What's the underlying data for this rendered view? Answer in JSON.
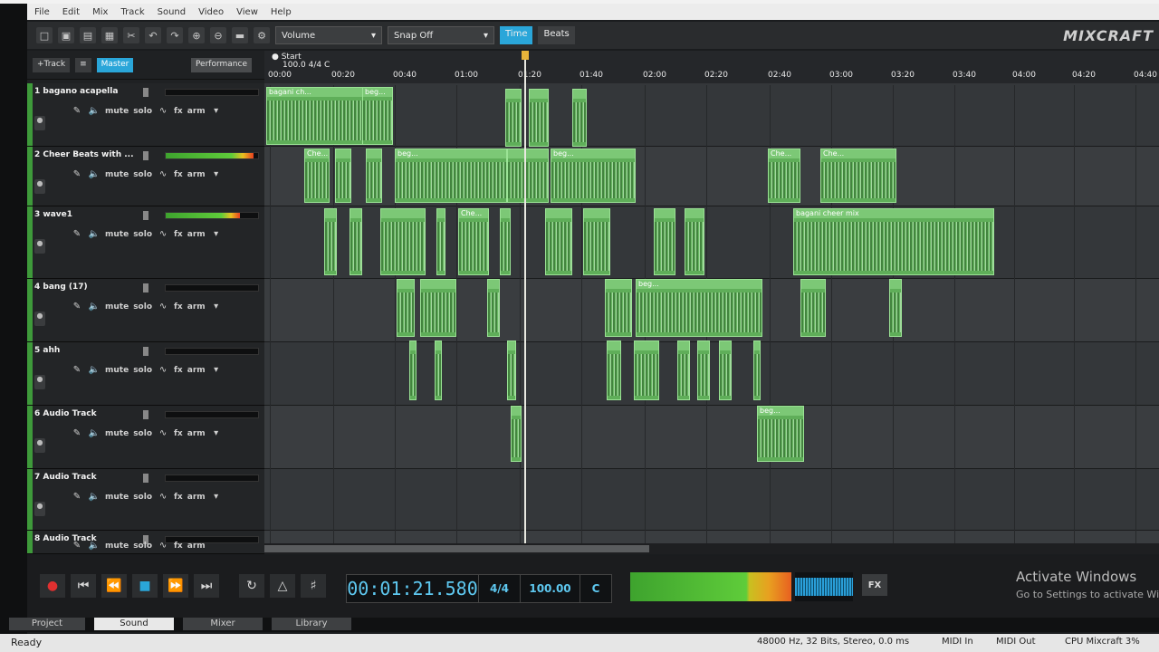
{
  "menu": [
    "File",
    "Edit",
    "Mix",
    "Track",
    "Sound",
    "Video",
    "View",
    "Help"
  ],
  "toolbar": {
    "volume_select": "Volume",
    "snap_select": "Snap Off",
    "time_toggle": "Time",
    "beats_toggle": "Beats",
    "brand": "MIXCRAFT"
  },
  "header_panel": {
    "add_track": "+Track",
    "master": "Master",
    "performance": "Performance"
  },
  "tracks": [
    {
      "name": "1 bagano acapella",
      "mute": "mute",
      "solo": "solo",
      "fx": "fx",
      "arm": "arm",
      "meter": 0
    },
    {
      "name": "2 Cheer Beats with ...",
      "mute": "mute",
      "solo": "solo",
      "fx": "fx",
      "arm": "arm",
      "meter": 0.95
    },
    {
      "name": "3 wave1",
      "mute": "mute",
      "solo": "solo",
      "fx": "fx",
      "arm": "arm",
      "meter": 0.8
    },
    {
      "name": "4 bang (17)",
      "mute": "mute",
      "solo": "solo",
      "fx": "fx",
      "arm": "arm",
      "meter": 0
    },
    {
      "name": "5 ahh",
      "mute": "mute",
      "solo": "solo",
      "fx": "fx",
      "arm": "arm",
      "meter": 0
    },
    {
      "name": "6 Audio Track",
      "mute": "mute",
      "solo": "solo",
      "fx": "fx",
      "arm": "arm",
      "meter": 0
    },
    {
      "name": "7 Audio Track",
      "mute": "mute",
      "solo": "solo",
      "fx": "fx",
      "arm": "arm",
      "meter": 0
    },
    {
      "name": "8 Audio Track",
      "mute": "mute",
      "solo": "solo",
      "fx": "fx",
      "arm": "arm",
      "meter": 0
    }
  ],
  "ruler": {
    "start_label": "Start",
    "tempo_label": "100.0 4/4 C",
    "times": [
      "00:00",
      "00:20",
      "00:40",
      "01:00",
      "01:20",
      "01:40",
      "02:00",
      "02:20",
      "02:40",
      "03:00",
      "03:20",
      "03:40",
      "04:00",
      "04:20",
      "04:40"
    ]
  },
  "clip_labels": {
    "acapella": "bagani ch...",
    "cheer_mix": "bagani cheer mix",
    "cheer": "Che...",
    "beg": "beg..."
  },
  "transport": {
    "time": "00:01:21.580",
    "signature": "4/4",
    "tempo": "100.00",
    "key": "C",
    "fx": "FX"
  },
  "activate": {
    "title": "Activate Windows",
    "subtitle": "Go to Settings to activate Win"
  },
  "tabs": [
    "Project",
    "Sound",
    "Mixer",
    "Library"
  ],
  "active_tab": "Sound",
  "status": {
    "ready": "Ready",
    "format": "48000 Hz, 32 Bits, Stereo, 0.0 ms",
    "midi_in": "MIDI In",
    "midi_out": "MIDI Out",
    "cpu": "CPU Mixcraft 3%"
  }
}
